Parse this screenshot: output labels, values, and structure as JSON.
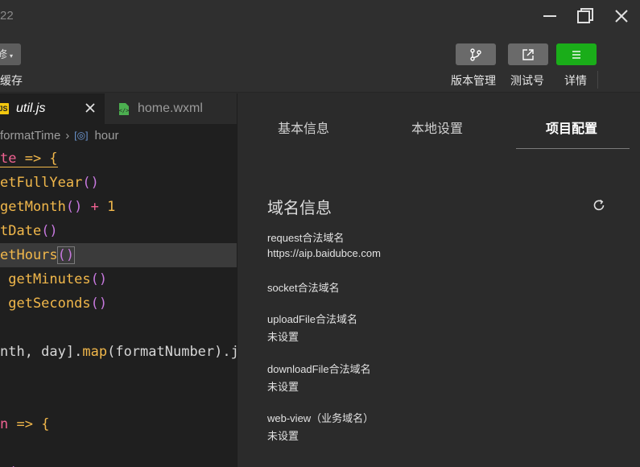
{
  "window": {
    "title_fragment": "22"
  },
  "toolbar": {
    "left_label": "缓存",
    "left_dropdown_text": "修",
    "version_label": "版本管理",
    "test_label": "测试号",
    "details_label": "详情"
  },
  "editor": {
    "tabs": [
      {
        "label": "util.js",
        "icon": "js-file-icon",
        "badge": "JS"
      },
      {
        "label": "home.wxml",
        "icon": "wxml-file-icon"
      }
    ],
    "breadcrumb": {
      "function": "formatTime",
      "symbol": "hour"
    },
    "lines": [
      {
        "t1": "te",
        "t2": " => {"
      },
      {
        "t1": "etFullYear",
        "t2": "()"
      },
      {
        "t1": "getMonth",
        "t2": "()",
        "t3": " + ",
        "t4": "1"
      },
      {
        "t1": "tDate",
        "t2": "()"
      },
      {
        "t1": "etHours",
        "t2": "()"
      },
      {
        "t1": " getMinutes",
        "t2": "()"
      },
      {
        "t1": " getSeconds",
        "t2": "()"
      },
      {
        "t1": "nth, day]",
        "t2": ".",
        "t3": "map",
        "t4": "(formatNumber).j"
      },
      {
        "t1": "n",
        "t2": " => {"
      },
      {
        "t1": "",
        "t2": "+("
      }
    ]
  },
  "panel": {
    "tabs": [
      "基本信息",
      "本地设置",
      "项目配置"
    ],
    "active_tab": 2,
    "section_title": "域名信息",
    "fields": [
      {
        "label": "request合法域名",
        "value": "https://aip.baidubce.com"
      },
      {
        "label": "socket合法域名",
        "value": ""
      },
      {
        "label": "uploadFile合法域名",
        "value": "未设置"
      },
      {
        "label": "downloadFile合法域名",
        "value": "未设置"
      },
      {
        "label": "web-view（业务域名）",
        "value": "未设置"
      }
    ]
  },
  "colors": {
    "accent_green": "#1aad19",
    "tool_gray": "#6a6a6a",
    "editor_bg": "#1f1f1f",
    "panel_bg": "#2b2b2b"
  }
}
